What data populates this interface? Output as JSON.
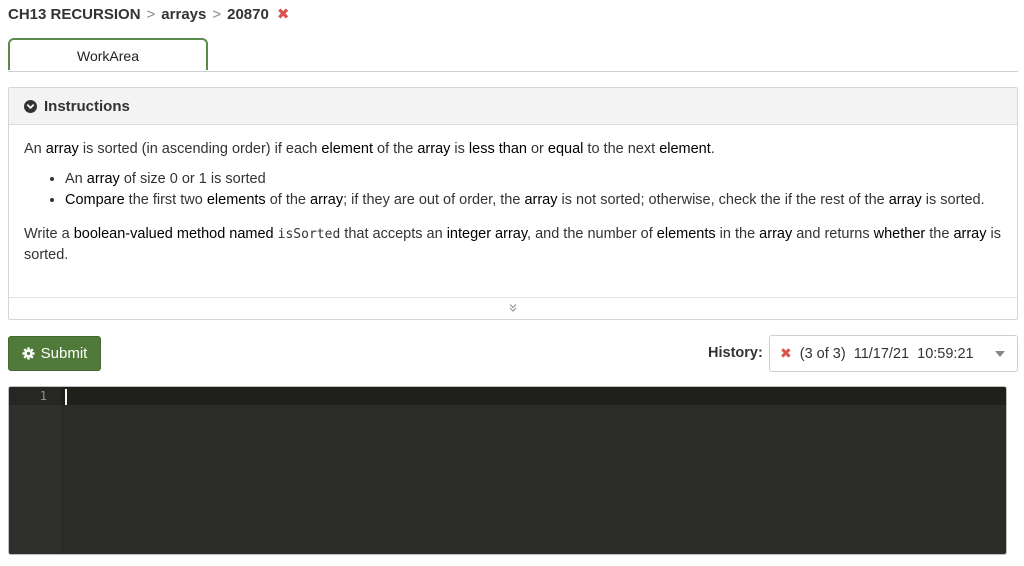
{
  "breadcrumb": {
    "chapter": "CH13 RECURSION",
    "sep1": ">",
    "section": "arrays",
    "sep2": ">",
    "exercise": "20870",
    "status_mark": "✖"
  },
  "tabs": [
    {
      "label": "WorkArea"
    }
  ],
  "instructions": {
    "title": "Instructions",
    "p1": {
      "a": "An ",
      "b": "array",
      "c": " is sorted (in ascending order) if each ",
      "d": "element",
      "e": " of the ",
      "f": "array",
      "g": " is ",
      "h": "less than",
      "i": " or ",
      "j": "equal",
      "k": " to the next ",
      "l": "element",
      "m": "."
    },
    "bullet1": {
      "a": "An ",
      "b": "array",
      "c": " of size 0 or 1 is sorted"
    },
    "bullet2": {
      "a": "Compare",
      "b": " the first two ",
      "c": "elements",
      "d": " of the ",
      "e": "array",
      "f": "; if they are out of order, the ",
      "g": "array",
      "h": " is not sorted; otherwise, check the if the rest of the ",
      "i": "array",
      "j": " is sorted."
    },
    "p2": {
      "a": "Write a ",
      "b": "boolean-valued method named",
      "c": " ",
      "d": "isSorted",
      "e": " that accepts an ",
      "f": "integer array",
      "g": ", and the number of ",
      "h": "elements",
      "i": " in the ",
      "j": "array",
      "k": " and returns ",
      "l": "whether",
      "m": " the ",
      "n": "array",
      "o": " is sorted."
    }
  },
  "toolbar": {
    "submit_label": "Submit"
  },
  "history": {
    "label": "History:",
    "status_mark": "✖",
    "selected": "(3 of 3)  11/17/21  10:59:21"
  },
  "editor": {
    "line_number": "1",
    "code": ""
  },
  "colors": {
    "accent_green": "#4f7a3a",
    "error_red": "#d9534f",
    "editor_bg": "#2b2c27"
  }
}
